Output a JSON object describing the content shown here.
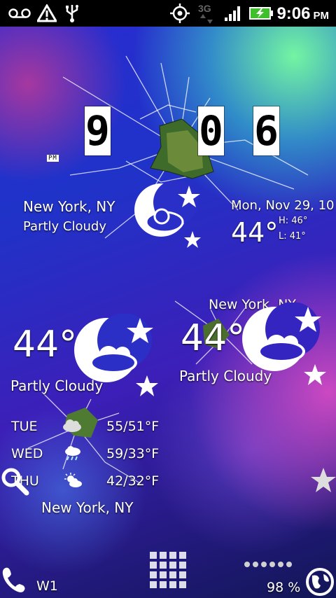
{
  "status_bar": {
    "network_type": "3G",
    "time": "9:06",
    "ampm": "PM",
    "icons": [
      "voicemail-icon",
      "warning-icon",
      "usb-icon",
      "gps-icon",
      "signal-icon",
      "battery-charging-icon"
    ]
  },
  "clock_widget": {
    "digits": [
      "9",
      "0",
      "6"
    ],
    "ampm_small": "PM",
    "location": "New York, NY",
    "condition": "Partly Cloudy",
    "date": "Mon, Nov 29, 10",
    "temperature": "44°",
    "high": "H: 46°",
    "low": "L: 41°"
  },
  "weather_widget_left": {
    "temperature": "44°",
    "condition": "Partly Cloudy",
    "forecast": [
      {
        "day": "TUE",
        "temps": "55/51°F",
        "icon": "cloudy-icon"
      },
      {
        "day": "WED",
        "temps": "59/33°F",
        "icon": "rain-icon"
      },
      {
        "day": "THU",
        "temps": "42/32°F",
        "icon": "sun-cloud-icon"
      }
    ],
    "location": "New York, NY"
  },
  "weather_widget_right": {
    "location": "New York, NY",
    "temperature": "44°",
    "condition": "Partly Cloudy"
  },
  "dock": {
    "phone_label": "W1",
    "battery_percent": "98 %",
    "icons": [
      "phone-icon",
      "app-drawer-icon",
      "globe-icon",
      "search-icon",
      "star-icon"
    ]
  }
}
